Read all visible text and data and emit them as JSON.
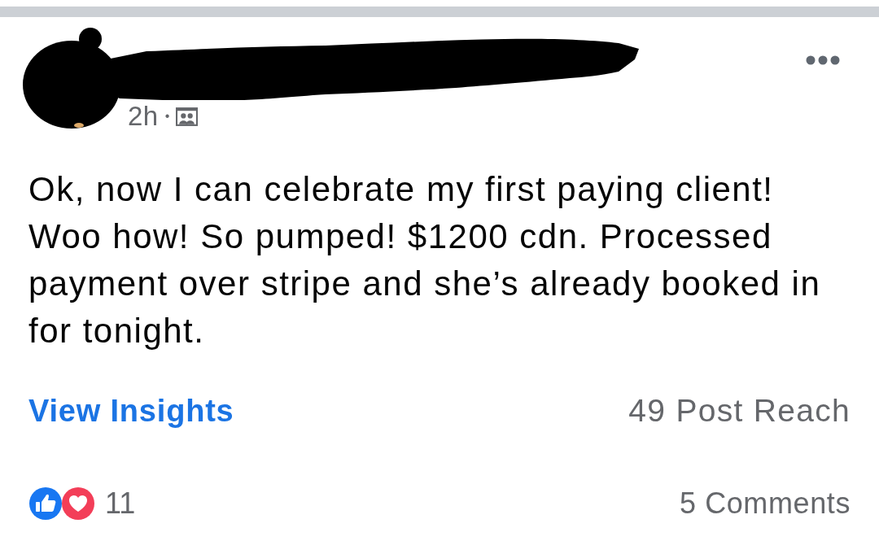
{
  "post": {
    "time": "2h",
    "separator": "•",
    "text": "Ok, now I can celebrate my first paying client! Woo how! So pumped! $1200 cdn. Processed payment over stripe and she’s already booked in for tonight.",
    "insights_link": "View Insights",
    "reach": "49 Post Reach",
    "reaction_count": "11",
    "comments": "5 Comments"
  }
}
